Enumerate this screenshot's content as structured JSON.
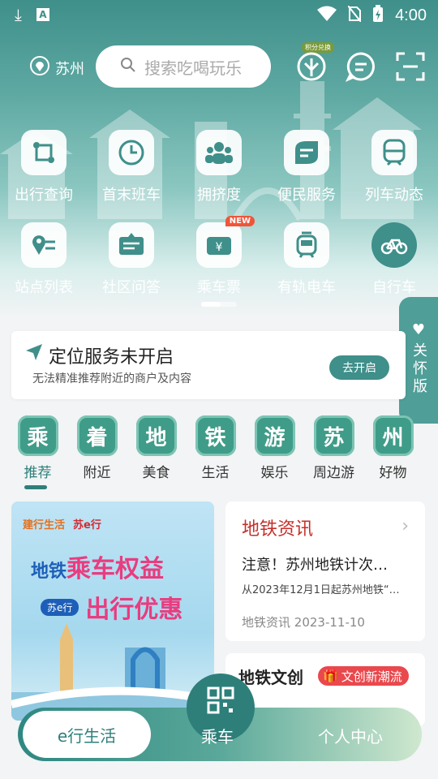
{
  "status": {
    "time": "4:00"
  },
  "header": {
    "city": "苏州",
    "search_placeholder": "搜索吃喝玩乐",
    "points_badge": "积分兑换"
  },
  "grid_row1": [
    {
      "label": "出行查询",
      "icon": "route-icon"
    },
    {
      "label": "首末班车",
      "icon": "clock-icon"
    },
    {
      "label": "拥挤度",
      "icon": "crowd-icon"
    },
    {
      "label": "便民服务",
      "icon": "service-icon"
    },
    {
      "label": "列车动态",
      "icon": "train-icon"
    }
  ],
  "grid_row2": [
    {
      "label": "站点列表",
      "icon": "station-list-icon"
    },
    {
      "label": "社区问答",
      "icon": "community-icon"
    },
    {
      "label": "乘车票",
      "icon": "ticket-icon",
      "badge": "NEW"
    },
    {
      "label": "有轨电车",
      "icon": "tram-icon"
    },
    {
      "label": "自行车",
      "icon": "bicycle-icon"
    }
  ],
  "care_mode": {
    "label": "关怀版"
  },
  "location_card": {
    "title": "定位服务未开启",
    "subtitle": "无法精准推荐附近的商户及内容",
    "button": "去开启"
  },
  "categories": [
    {
      "glyph": "乘",
      "label": "推荐"
    },
    {
      "glyph": "着",
      "label": "附近"
    },
    {
      "glyph": "地",
      "label": "美食"
    },
    {
      "glyph": "铁",
      "label": "生活"
    },
    {
      "glyph": "游",
      "label": "娱乐"
    },
    {
      "glyph": "苏",
      "label": "周边游"
    },
    {
      "glyph": "州",
      "label": "好物"
    }
  ],
  "banner": {
    "brand1": "建行生活",
    "brand2": "苏e行",
    "line1a": "地铁",
    "line1b": "乘车权益",
    "tag": "苏e行",
    "line2": "出行优惠"
  },
  "news": {
    "heading": "地铁资讯",
    "title": "注意！苏州地铁计次…",
    "subtitle": "从2023年12月1日起苏州地铁“…",
    "source": "地铁资讯",
    "date": "2023-11-10"
  },
  "wenchuang": {
    "heading": "地铁文创",
    "tag": "文创新潮流"
  },
  "tabbar": {
    "tab1": "e行生活",
    "tab2": "乘车",
    "tab3": "个人中心"
  },
  "colors": {
    "primary": "#2e7f7a",
    "accent_red": "#e9484d",
    "news_red": "#c4302b"
  }
}
